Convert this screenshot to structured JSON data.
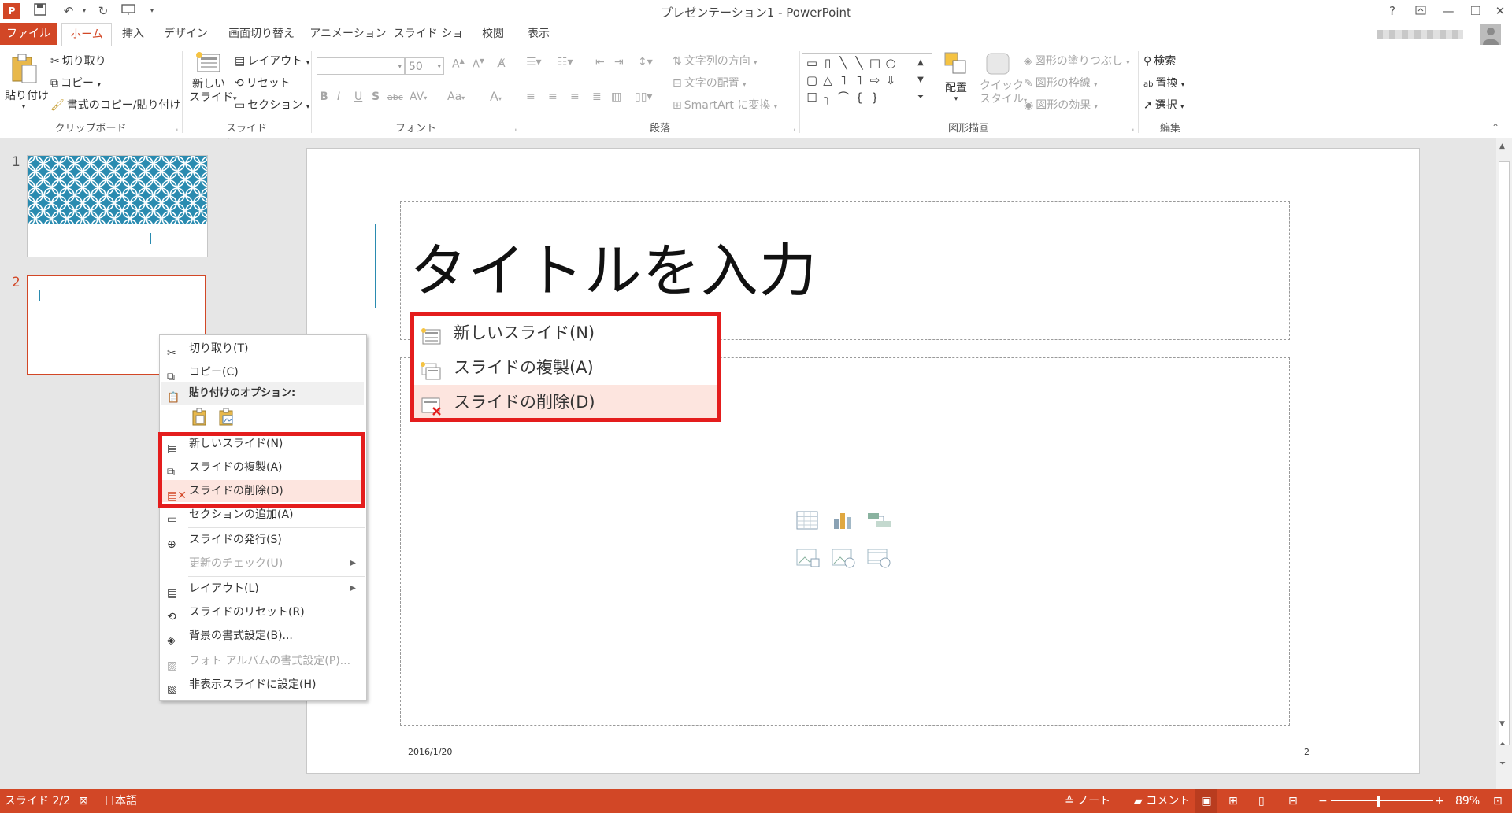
{
  "app": {
    "title": "プレゼンテーション1 - PowerPoint",
    "help": "?",
    "window_buttons": [
      "ribbon-display-options",
      "minimize",
      "restore",
      "close"
    ]
  },
  "tabs": [
    "ファイル",
    "ホーム",
    "挿入",
    "デザイン",
    "画面切り替え",
    "アニメーション",
    "スライド ショー",
    "校閲",
    "表示"
  ],
  "ribbon": {
    "clipboard": {
      "label": "クリップボード",
      "paste": "貼り付け",
      "cut": "切り取り",
      "copy": "コピー",
      "format_painter": "書式のコピー/貼り付け"
    },
    "slides": {
      "label": "スライド",
      "new_slide_line1": "新しい",
      "new_slide_line2": "スライド",
      "layout": "レイアウト",
      "reset": "リセット",
      "section": "セクション"
    },
    "font": {
      "label": "フォント",
      "font_size": "50",
      "buttons": [
        "B",
        "I",
        "U",
        "S",
        "abc",
        "AV",
        "Aa",
        "A"
      ]
    },
    "paragraph": {
      "label": "段落",
      "text_direction": "文字列の方向",
      "align_text": "文字の配置",
      "smartart": "SmartArt に変換"
    },
    "drawing": {
      "label": "図形描画",
      "arrange": "配置",
      "quick_styles_line1": "クイック",
      "quick_styles_line2": "スタイル",
      "shape_fill": "図形の塗りつぶし",
      "shape_outline": "図形の枠線",
      "shape_effects": "図形の効果"
    },
    "editing": {
      "label": "編集",
      "find": "検索",
      "replace": "置換",
      "select": "選択"
    }
  },
  "thumbnails": {
    "items": [
      {
        "number": "1"
      },
      {
        "number": "2",
        "selected": true
      }
    ]
  },
  "slide": {
    "title_placeholder": "タイトルを入力",
    "footer_date": "2016/1/20",
    "footer_page": "2"
  },
  "context_menu": {
    "items": [
      {
        "label": "切り取り(T)",
        "icon": "scissors-icon"
      },
      {
        "label": "コピー(C)",
        "icon": "copy-icon"
      },
      {
        "label": "貼り付けのオプション:",
        "icon": "paste-icon",
        "header": true
      },
      {
        "label": "新しいスライド(N)",
        "icon": "new-slide-icon"
      },
      {
        "label": "スライドの複製(A)",
        "icon": "duplicate-slide-icon"
      },
      {
        "label": "スライドの削除(D)",
        "icon": "delete-slide-icon",
        "highlighted": true
      },
      {
        "label": "セクションの追加(A)",
        "icon": "section-icon"
      },
      {
        "label": "スライドの発行(S)",
        "icon": "publish-icon"
      },
      {
        "label": "更新のチェック(U)",
        "icon": "",
        "disabled": true
      },
      {
        "label": "レイアウト(L)",
        "icon": "layout-icon"
      },
      {
        "label": "スライドのリセット(R)",
        "icon": "reset-icon"
      },
      {
        "label": "背景の書式設定(B)...",
        "icon": "background-icon"
      },
      {
        "label": "フォト アルバムの書式設定(P)...",
        "icon": "photo-album-icon",
        "disabled": true
      },
      {
        "label": "非表示スライドに設定(H)",
        "icon": "hide-slide-icon"
      }
    ]
  },
  "callout": {
    "items": [
      {
        "label": "新しいスライド(N)"
      },
      {
        "label": "スライドの複製(A)"
      },
      {
        "label": "スライドの削除(D)",
        "highlighted": true
      }
    ]
  },
  "status": {
    "slide_indicator": "スライド 2/2",
    "language": "日本語",
    "notes": "ノート",
    "comments": "コメント",
    "zoom": "89%"
  },
  "colors": {
    "accent": "#d24726",
    "highlight_red": "#e41d1d",
    "menu_hover": "#fde5df",
    "teal_pattern": "#2a8bb0"
  }
}
